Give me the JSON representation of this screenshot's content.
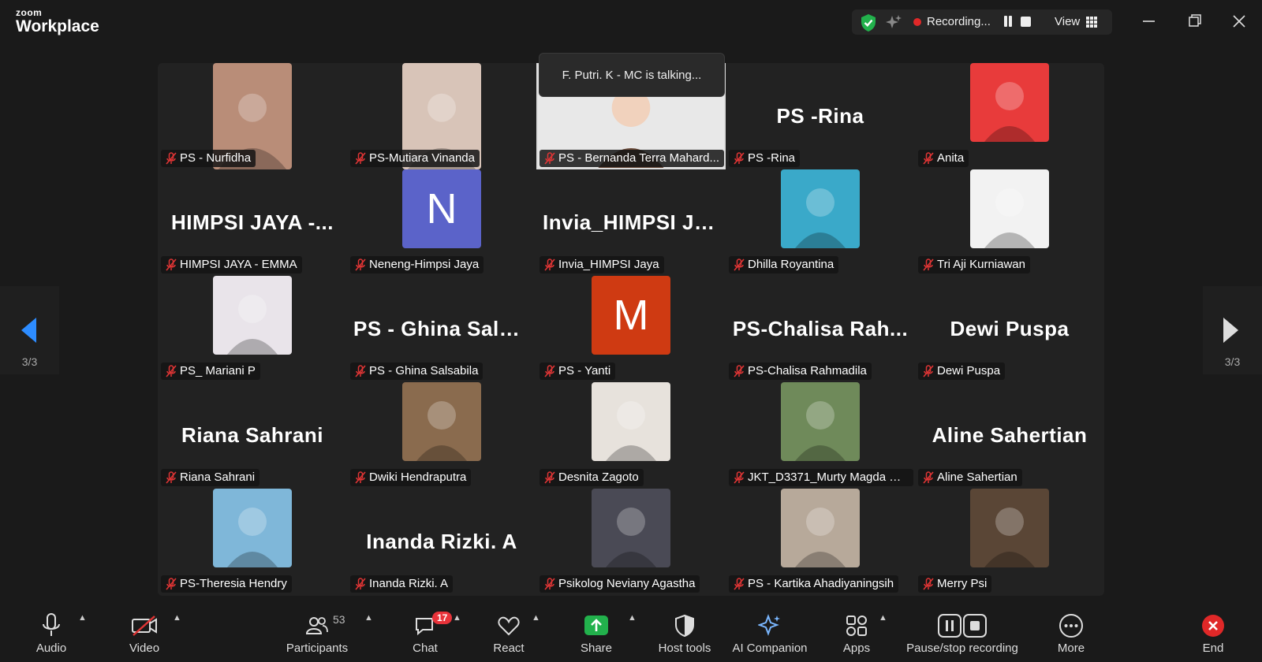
{
  "app": {
    "brand_top": "zoom",
    "brand_bottom": "Workplace"
  },
  "status": {
    "recording_text": "Recording...",
    "view_text": "View"
  },
  "speaking": {
    "text": "F. Putri. K - MC is talking..."
  },
  "page_indicator": {
    "left": "3/3",
    "right": "3/3"
  },
  "tiles": [
    {
      "label": "PS - Nurfidha",
      "big": "",
      "kind": "photo",
      "color": "#b98d78"
    },
    {
      "label": "PS-Mutiara Vinanda",
      "big": "",
      "kind": "photo",
      "color": "#d8c4b8"
    },
    {
      "label": "PS - Bernanda Terra Mahard...",
      "big": "",
      "kind": "memoji",
      "color": "#e8e8e8"
    },
    {
      "label": "PS -Rina",
      "big": "PS -Rina",
      "kind": "name",
      "color": ""
    },
    {
      "label": "Anita",
      "big": "",
      "kind": "photo",
      "color": "#e83b3b"
    },
    {
      "label": "HIMPSI JAYA - EMMA",
      "big": "HIMPSI JAYA -...",
      "kind": "name",
      "color": ""
    },
    {
      "label": "Neneng-Himpsi Jaya",
      "big": "",
      "kind": "letter",
      "letter": "N",
      "color": "#5b63c9"
    },
    {
      "label": "Invia_HIMPSI Jaya",
      "big": "Invia_HIMPSI Ja...",
      "kind": "name",
      "color": ""
    },
    {
      "label": "Dhilla Royantina",
      "big": "",
      "kind": "photo",
      "color": "#3aa9c9"
    },
    {
      "label": "Tri Aji Kurniawan",
      "big": "",
      "kind": "photo",
      "color": "#f2f2f2"
    },
    {
      "label": "PS_ Mariani P",
      "big": "",
      "kind": "photo",
      "color": "#e9e4ea"
    },
    {
      "label": "PS - Ghina Salsabila",
      "big": "PS - Ghina Salsa...",
      "kind": "name",
      "color": ""
    },
    {
      "label": "PS - Yanti",
      "big": "",
      "kind": "letter",
      "letter": "M",
      "color": "#cf3a12"
    },
    {
      "label": "PS-Chalisa Rahmadila",
      "big": "PS-Chalisa Rah...",
      "kind": "name",
      "color": ""
    },
    {
      "label": "Dewi Puspa",
      "big": "Dewi Puspa",
      "kind": "name",
      "color": ""
    },
    {
      "label": "Riana Sahrani",
      "big": "Riana Sahrani",
      "kind": "name",
      "color": ""
    },
    {
      "label": "Dwiki Hendraputra",
      "big": "",
      "kind": "photo",
      "color": "#8a6b4e"
    },
    {
      "label": "Desnita Zagoto",
      "big": "",
      "kind": "photo",
      "color": "#e7e2dc"
    },
    {
      "label": "JKT_D3371_Murty Magda Pa...",
      "big": "",
      "kind": "photo",
      "color": "#6f8a5a"
    },
    {
      "label": "Aline Sahertian",
      "big": "Aline Sahertian",
      "kind": "name",
      "color": ""
    },
    {
      "label": "PS-Theresia Hendry",
      "big": "",
      "kind": "photo",
      "color": "#7fb7d9"
    },
    {
      "label": "Inanda Rizki. A",
      "big": "Inanda Rizki. A",
      "kind": "name",
      "color": ""
    },
    {
      "label": "Psikolog Neviany Agastha",
      "big": "",
      "kind": "photo",
      "color": "#4a4a55"
    },
    {
      "label": "PS - Kartika Ahadiyaningsih",
      "big": "",
      "kind": "photo",
      "color": "#b7a99a"
    },
    {
      "label": "Merry Psi",
      "big": "",
      "kind": "photo",
      "color": "#5a4636"
    }
  ],
  "toolbar": {
    "audio": "Audio",
    "video": "Video",
    "participants": "Participants",
    "participants_count": "53",
    "chat": "Chat",
    "chat_badge": "17",
    "react": "React",
    "share": "Share",
    "host_tools": "Host tools",
    "ai_companion": "AI Companion",
    "apps": "Apps",
    "pause_stop": "Pause/stop recording",
    "more": "More",
    "end": "End"
  },
  "colors": {
    "accent_green": "#22b14c",
    "mute_red": "#e03535",
    "end_red": "#e02828"
  }
}
